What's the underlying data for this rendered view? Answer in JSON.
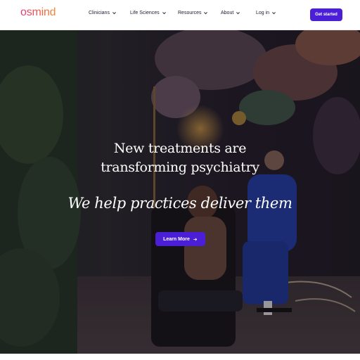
{
  "header": {
    "logo": "osmind",
    "nav": [
      {
        "label": "Clinicians",
        "icon": "chevron-down-icon"
      },
      {
        "label": "Life Sciences",
        "icon": "chevron-down-icon"
      },
      {
        "label": "Resources",
        "icon": "chevron-down-icon"
      },
      {
        "label": "About",
        "icon": "chevron-down-icon"
      },
      {
        "label": "Log in",
        "icon": "chevron-down-icon"
      }
    ],
    "cta_label": "Get started"
  },
  "hero": {
    "headline_line1": "New treatments are",
    "headline_line2": "transforming psychiatry",
    "subhead": "We help practices deliver them",
    "button_label": "Learn More",
    "button_icon": "arrow-right-icon"
  },
  "colors": {
    "brand_purple": "#4b1fd6",
    "logo_gradient_start": "#e0397a",
    "logo_gradient_end": "#f08a3a",
    "nav_text": "#1d1b2f"
  }
}
